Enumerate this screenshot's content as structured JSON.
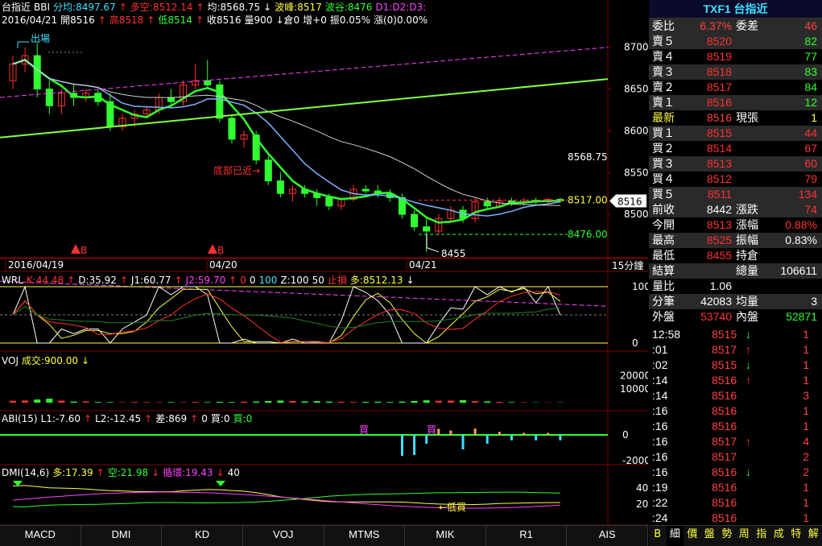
{
  "header": {
    "line1": [
      {
        "text": "台指近",
        "color": "white"
      },
      {
        "text": "BBI",
        "color": "white"
      },
      {
        "text": "分均:8497.67",
        "color": "cyan"
      },
      {
        "text": "↑",
        "color": "red"
      },
      {
        "text": "多空:8512.14",
        "color": "red"
      },
      {
        "text": "↑",
        "color": "red"
      },
      {
        "text": "均:8568.75",
        "color": "white"
      },
      {
        "text": "↓",
        "color": "white"
      },
      {
        "text": "波峰:8517",
        "color": "yellow"
      },
      {
        "text": "波谷:8476",
        "color": "green"
      },
      {
        "text": "D1:D2:D3:",
        "color": "magenta"
      }
    ],
    "line2": [
      {
        "text": "2016/04/21",
        "color": "white"
      },
      {
        "text": "開8516",
        "color": "white"
      },
      {
        "text": "↑",
        "color": "red"
      },
      {
        "text": "高8518",
        "color": "red"
      },
      {
        "text": "↑",
        "color": "red"
      },
      {
        "text": "低8514",
        "color": "green"
      },
      {
        "text": "↑",
        "color": "red"
      },
      {
        "text": "收8516",
        "color": "white"
      },
      {
        "text": "量900",
        "color": "white"
      },
      {
        "text": "↓倉0",
        "color": "white"
      },
      {
        "text": "增+0",
        "color": "white"
      },
      {
        "text": "振0.05%",
        "color": "white"
      },
      {
        "text": "漲(0)0.00%",
        "color": "white"
      }
    ]
  },
  "wrl_header": [
    {
      "text": "WRL",
      "color": "white"
    },
    {
      "text": "K:44.48",
      "color": "red"
    },
    {
      "text": "↑",
      "color": "red"
    },
    {
      "text": "D:35.92",
      "color": "white"
    },
    {
      "text": "↑",
      "color": "red"
    },
    {
      "text": "J1:60.77",
      "color": "white"
    },
    {
      "text": "↑",
      "color": "red"
    },
    {
      "text": "J2:59.70",
      "color": "magenta"
    },
    {
      "text": "↑",
      "color": "red"
    },
    {
      "text": "0",
      "color": "red"
    },
    {
      "text": "0",
      "color": "white"
    },
    {
      "text": "100",
      "color": "cyan"
    },
    {
      "text": "Z:100",
      "color": "white"
    },
    {
      "text": "50",
      "color": "white"
    },
    {
      "text": "止損",
      "color": "red"
    },
    {
      "text": "多:8512.13",
      "color": "yellow"
    },
    {
      "text": "↓",
      "color": "white"
    }
  ],
  "voj_header": [
    {
      "text": "VOJ",
      "color": "white"
    },
    {
      "text": "成交:900.00",
      "color": "yellow"
    },
    {
      "text": "↓",
      "color": "yellow"
    }
  ],
  "abi_header": [
    {
      "text": "ABI(15)",
      "color": "white"
    },
    {
      "text": "L1:-7.60",
      "color": "white"
    },
    {
      "text": "↑",
      "color": "red"
    },
    {
      "text": "L2:-12.45",
      "color": "white"
    },
    {
      "text": "↑",
      "color": "red"
    },
    {
      "text": "差:869",
      "color": "white"
    },
    {
      "text": "↑",
      "color": "red"
    },
    {
      "text": "0",
      "color": "white"
    },
    {
      "text": "買:0",
      "color": "white"
    },
    {
      "text": "買:0",
      "color": "green"
    }
  ],
  "dmi_header": [
    {
      "text": "DMI(14,6)",
      "color": "white"
    },
    {
      "text": "多:17.39",
      "color": "yellow"
    },
    {
      "text": "↑",
      "color": "red"
    },
    {
      "text": "空:21.98",
      "color": "green"
    },
    {
      "text": "↓",
      "color": "red"
    },
    {
      "text": "循環:19.43",
      "color": "magenta"
    },
    {
      "text": "↓",
      "color": "red"
    },
    {
      "text": "40",
      "color": "white"
    }
  ],
  "chart_data": [
    {
      "type": "candlestick",
      "title": "台指近 15分鐘",
      "x_labels": [
        "2016/04/19",
        "04/20",
        "04/21"
      ],
      "timeframe": "15分鐘",
      "ylim": [
        8450,
        8720
      ],
      "y_ticks": [
        8500,
        8550,
        8600,
        8650,
        8700
      ],
      "candles": [
        {
          "o": 8660,
          "h": 8690,
          "l": 8650,
          "c": 8680
        },
        {
          "o": 8680,
          "h": 8700,
          "l": 8670,
          "c": 8690
        },
        {
          "o": 8690,
          "h": 8705,
          "l": 8640,
          "c": 8650
        },
        {
          "o": 8650,
          "h": 8660,
          "l": 8620,
          "c": 8630
        },
        {
          "o": 8630,
          "h": 8650,
          "l": 8620,
          "c": 8645
        },
        {
          "o": 8645,
          "h": 8655,
          "l": 8630,
          "c": 8640
        },
        {
          "o": 8640,
          "h": 8650,
          "l": 8635,
          "c": 8645
        },
        {
          "o": 8645,
          "h": 8650,
          "l": 8630,
          "c": 8635
        },
        {
          "o": 8635,
          "h": 8645,
          "l": 8600,
          "c": 8605
        },
        {
          "o": 8605,
          "h": 8620,
          "l": 8600,
          "c": 8615
        },
        {
          "o": 8615,
          "h": 8625,
          "l": 8605,
          "c": 8620
        },
        {
          "o": 8620,
          "h": 8630,
          "l": 8615,
          "c": 8625
        },
        {
          "o": 8625,
          "h": 8645,
          "l": 8620,
          "c": 8640
        },
        {
          "o": 8640,
          "h": 8650,
          "l": 8630,
          "c": 8635
        },
        {
          "o": 8635,
          "h": 8660,
          "l": 8630,
          "c": 8655
        },
        {
          "o": 8655,
          "h": 8680,
          "l": 8650,
          "c": 8660
        },
        {
          "o": 8660,
          "h": 8685,
          "l": 8650,
          "c": 8655
        },
        {
          "o": 8655,
          "h": 8660,
          "l": 8610,
          "c": 8615
        },
        {
          "o": 8615,
          "h": 8620,
          "l": 8585,
          "c": 8590
        },
        {
          "o": 8590,
          "h": 8600,
          "l": 8580,
          "c": 8595
        },
        {
          "o": 8595,
          "h": 8600,
          "l": 8560,
          "c": 8565
        },
        {
          "o": 8565,
          "h": 8570,
          "l": 8535,
          "c": 8540
        },
        {
          "o": 8540,
          "h": 8550,
          "l": 8520,
          "c": 8525
        },
        {
          "o": 8525,
          "h": 8535,
          "l": 8515,
          "c": 8530
        },
        {
          "o": 8530,
          "h": 8535,
          "l": 8520,
          "c": 8525
        },
        {
          "o": 8525,
          "h": 8530,
          "l": 8510,
          "c": 8520
        },
        {
          "o": 8520,
          "h": 8525,
          "l": 8505,
          "c": 8510
        },
        {
          "o": 8510,
          "h": 8520,
          "l": 8505,
          "c": 8518
        },
        {
          "o": 8518,
          "h": 8535,
          "l": 8515,
          "c": 8530
        },
        {
          "o": 8530,
          "h": 8535,
          "l": 8525,
          "c": 8528
        },
        {
          "o": 8528,
          "h": 8535,
          "l": 8520,
          "c": 8525
        },
        {
          "o": 8525,
          "h": 8530,
          "l": 8515,
          "c": 8520
        },
        {
          "o": 8520,
          "h": 8525,
          "l": 8495,
          "c": 8500
        },
        {
          "o": 8500,
          "h": 8505,
          "l": 8480,
          "c": 8485
        },
        {
          "o": 8485,
          "h": 8495,
          "l": 8455,
          "c": 8480
        },
        {
          "o": 8480,
          "h": 8500,
          "l": 8475,
          "c": 8495
        },
        {
          "o": 8495,
          "h": 8510,
          "l": 8490,
          "c": 8505
        },
        {
          "o": 8505,
          "h": 8510,
          "l": 8490,
          "c": 8495
        },
        {
          "o": 8495,
          "h": 8520,
          "l": 8490,
          "c": 8515
        },
        {
          "o": 8515,
          "h": 8520,
          "l": 8505,
          "c": 8510
        },
        {
          "o": 8510,
          "h": 8520,
          "l": 8508,
          "c": 8516
        },
        {
          "o": 8516,
          "h": 8520,
          "l": 8510,
          "c": 8514
        },
        {
          "o": 8514,
          "h": 8520,
          "l": 8510,
          "c": 8517
        },
        {
          "o": 8517,
          "h": 8520,
          "l": 8512,
          "c": 8515
        },
        {
          "o": 8515,
          "h": 8520,
          "l": 8512,
          "c": 8518
        },
        {
          "o": 8518,
          "h": 8520,
          "l": 8514,
          "c": 8516
        }
      ],
      "line_labels": [
        {
          "text": "8568.75",
          "value": 8568.75,
          "color": "white"
        },
        {
          "text": "8517.00",
          "value": 8517,
          "color": "yellow"
        },
        {
          "text": "8476.00",
          "value": 8476,
          "color": "green"
        },
        {
          "text": "8455",
          "value": 8455,
          "color": "white"
        }
      ],
      "current_price": "8516",
      "annotations": [
        {
          "text": "出場",
          "color": "cyan"
        },
        {
          "text": "底部已近→",
          "color": "red"
        },
        {
          "text": "B",
          "color": "red"
        },
        {
          "text": "B",
          "color": "red"
        }
      ]
    },
    {
      "type": "line",
      "name": "WRL",
      "y_ticks": [
        0,
        100
      ],
      "ylim": [
        0,
        100
      ]
    },
    {
      "type": "bar",
      "name": "VOJ",
      "y_ticks": [
        20000,
        10000
      ],
      "ylim": [
        0,
        25000
      ],
      "values": [
        1400,
        1600,
        2300,
        2900,
        1500,
        800,
        900,
        500,
        400,
        300,
        500,
        400,
        300,
        400,
        300,
        500,
        400,
        600,
        500,
        700,
        800,
        1200,
        1500,
        1200,
        900,
        1100,
        800,
        700,
        500,
        600,
        700,
        500,
        800,
        1200,
        1700,
        1400,
        1500,
        1800,
        1100,
        900,
        600,
        400,
        300,
        200,
        200,
        200
      ]
    },
    {
      "type": "bar",
      "name": "ABI(15)",
      "y_ticks": [
        0,
        -2000
      ],
      "labels": [
        "買",
        "買"
      ]
    },
    {
      "type": "line",
      "name": "DMI(14,6)",
      "y_ticks": [
        40,
        20
      ],
      "annotations": [
        {
          "text": "←低買",
          "color": "yellow"
        }
      ]
    }
  ],
  "right_panel": {
    "title": "TXF1 台指近",
    "weibi": {
      "label": "委比",
      "value": "6.37%",
      "label2": "委差",
      "value2": "46"
    },
    "asks": [
      {
        "label": "賣５",
        "price": "8520",
        "qty": "82"
      },
      {
        "label": "賣４",
        "price": "8519",
        "qty": "77"
      },
      {
        "label": "賣３",
        "price": "8518",
        "qty": "83"
      },
      {
        "label": "賣２",
        "price": "8517",
        "qty": "84"
      },
      {
        "label": "賣１",
        "price": "8516",
        "qty": "12"
      }
    ],
    "latest": {
      "label": "最新",
      "price": "8516",
      "label2": "現張",
      "qty": "1"
    },
    "bids": [
      {
        "label": "買１",
        "price": "8515",
        "qty": "44"
      },
      {
        "label": "買２",
        "price": "8514",
        "qty": "67"
      },
      {
        "label": "買３",
        "price": "8513",
        "qty": "60"
      },
      {
        "label": "買４",
        "price": "8512",
        "qty": "79"
      },
      {
        "label": "買５",
        "price": "8511",
        "qty": "134"
      }
    ],
    "stats": [
      {
        "l1": "前收",
        "v1": "8442",
        "c1": "white",
        "l2": "漲跌",
        "v2": "74",
        "c2": "red"
      },
      {
        "l1": "今開",
        "v1": "8513",
        "c1": "red",
        "l2": "漲幅",
        "v2": "0.88%",
        "c2": "red"
      },
      {
        "l1": "最高",
        "v1": "8525",
        "c1": "red",
        "l2": "振幅",
        "v2": "0.83%",
        "c2": "white"
      },
      {
        "l1": "最低",
        "v1": "8455",
        "c1": "red",
        "l2": "持倉",
        "v2": "",
        "c2": "white"
      },
      {
        "l1": "結算",
        "v1": "",
        "c1": "white",
        "l2": "總量",
        "v2": "106611",
        "c2": "white"
      },
      {
        "l1": "量比",
        "v1": "1.06",
        "c1": "white",
        "l2": "",
        "v2": "",
        "c2": "white"
      },
      {
        "l1": "分筆",
        "v1": "42083",
        "c1": "white",
        "l2": "均量",
        "v2": "3",
        "c2": "white"
      },
      {
        "l1": "外盤",
        "v1": "53740",
        "c1": "red",
        "l2": "內盤",
        "v2": "52871",
        "c2": "green"
      }
    ],
    "ticks": [
      {
        "time": "12:58",
        "price": "8515",
        "arrow": "↓",
        "dir": "down",
        "vol": "1"
      },
      {
        "time": ":01",
        "price": "8517",
        "arrow": "↑",
        "dir": "up",
        "vol": "1"
      },
      {
        "time": ":02",
        "price": "8515",
        "arrow": "↓",
        "dir": "down",
        "vol": "1"
      },
      {
        "time": ":14",
        "price": "8516",
        "arrow": "↑",
        "dir": "up",
        "vol": "1"
      },
      {
        "time": ":14",
        "price": "8516",
        "arrow": "",
        "dir": "",
        "vol": "3"
      },
      {
        "time": ":16",
        "price": "8516",
        "arrow": "",
        "dir": "",
        "vol": "1"
      },
      {
        "time": ":16",
        "price": "8516",
        "arrow": "",
        "dir": "",
        "vol": "1"
      },
      {
        "time": ":16",
        "price": "8517",
        "arrow": "↑",
        "dir": "up",
        "vol": "4"
      },
      {
        "time": ":16",
        "price": "8517",
        "arrow": "",
        "dir": "",
        "vol": "2"
      },
      {
        "time": ":16",
        "price": "8516",
        "arrow": "↓",
        "dir": "down",
        "vol": "2"
      },
      {
        "time": ":19",
        "price": "8516",
        "arrow": "",
        "dir": "",
        "vol": "1"
      },
      {
        "time": ":22",
        "price": "8516",
        "arrow": "",
        "dir": "",
        "vol": "1"
      },
      {
        "time": ":24",
        "price": "8516",
        "arrow": "",
        "dir": "",
        "vol": "1"
      }
    ]
  },
  "bottom_tabs": [
    "MACD",
    "DMI",
    "KD",
    "VOJ",
    "MTMS",
    "MIK",
    "R1",
    "AIS"
  ],
  "right_tabs": [
    "B",
    "細",
    "價",
    "盤",
    "勢",
    "周",
    "指",
    "成",
    "特",
    "解"
  ],
  "colors": {
    "up": "#ff3030",
    "down": "#30ff30",
    "bg": "#000000",
    "grid": "#800000",
    "white": "#ffffff",
    "cyan": "#40e0ff",
    "yellow": "#ffff40",
    "magenta": "#ff40ff",
    "blue": "#80b0ff"
  }
}
